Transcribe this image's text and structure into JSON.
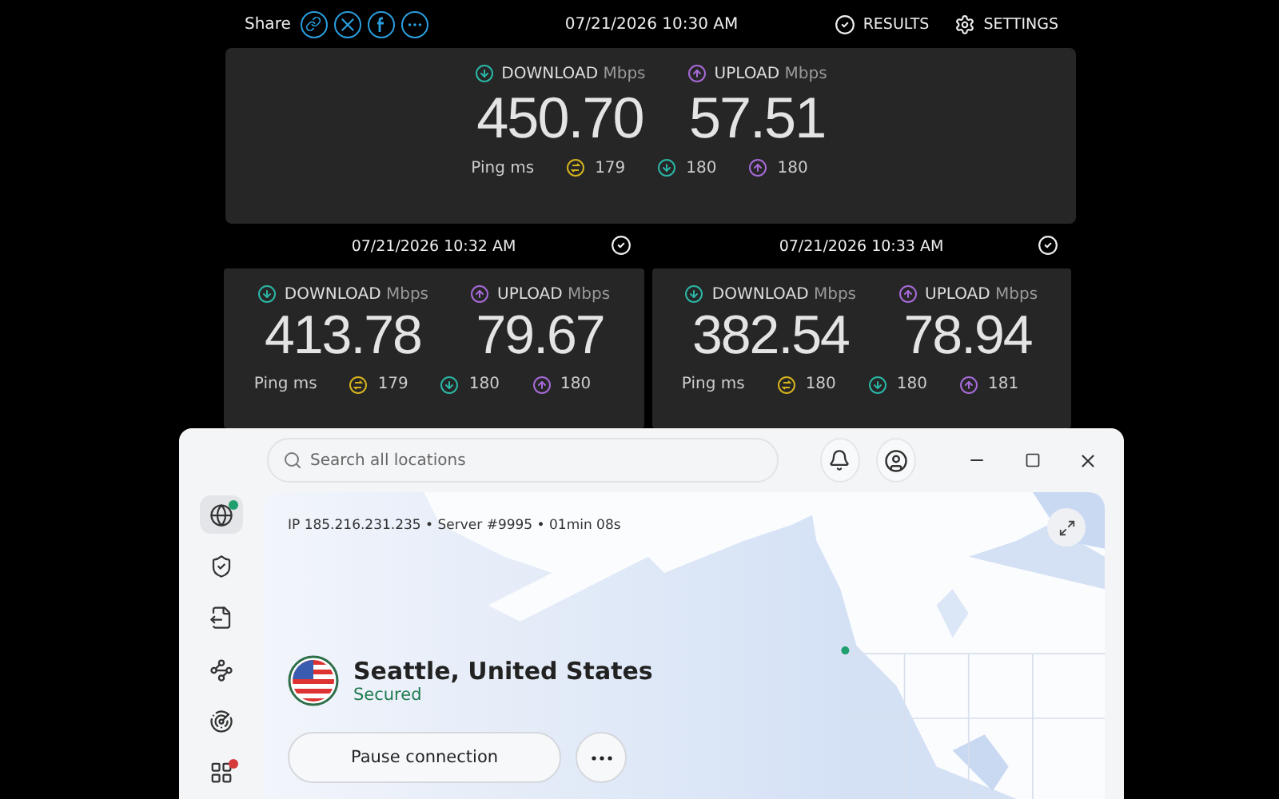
{
  "top_bar": {
    "share_label": "Share",
    "timestamp": "07/21/2026 10:30 AM",
    "links": [
      {
        "kind": "results",
        "label": "RESULTS"
      },
      {
        "kind": "settings",
        "label": "SETTINGS"
      }
    ]
  },
  "current_result": {
    "download": {
      "label": "DOWNLOAD",
      "unit": "Mbps",
      "value": "450.70"
    },
    "upload": {
      "label": "UPLOAD",
      "unit": "Mbps",
      "value": "57.51"
    },
    "ping_label": "Ping ms",
    "ping": {
      "idle": "179",
      "download": "180",
      "upload": "180"
    }
  },
  "history": [
    {
      "timestamp": "07/21/2026 10:32 AM",
      "download": {
        "label": "DOWNLOAD",
        "unit": "Mbps",
        "value": "413.78"
      },
      "upload": {
        "label": "UPLOAD",
        "unit": "Mbps",
        "value": "79.67"
      },
      "ping_label": "Ping ms",
      "ping": {
        "idle": "179",
        "download": "180",
        "upload": "180"
      }
    },
    {
      "timestamp": "07/21/2026 10:33 AM",
      "download": {
        "label": "DOWNLOAD",
        "unit": "Mbps",
        "value": "382.54"
      },
      "upload": {
        "label": "UPLOAD",
        "unit": "Mbps",
        "value": "78.94"
      },
      "ping_label": "Ping ms",
      "ping": {
        "idle": "180",
        "download": "180",
        "upload": "181"
      }
    }
  ],
  "vpn_window": {
    "search": {
      "placeholder": "Search all locations"
    },
    "sidebar": [
      {
        "kind": "globe",
        "selected": true,
        "color": "#1f9e6e"
      },
      {
        "kind": "shield",
        "selected": false
      },
      {
        "kind": "file",
        "selected": false
      },
      {
        "kind": "nodes",
        "selected": false
      },
      {
        "kind": "radar",
        "selected": false
      },
      {
        "kind": "apps",
        "selected": false,
        "color": "#d63a3a"
      }
    ],
    "connection_info": "IP 185.216.231.235 • Server #9995 • 01min 08s",
    "location": "Seattle, United States",
    "status": "Secured",
    "pause_button": "Pause connection"
  }
}
